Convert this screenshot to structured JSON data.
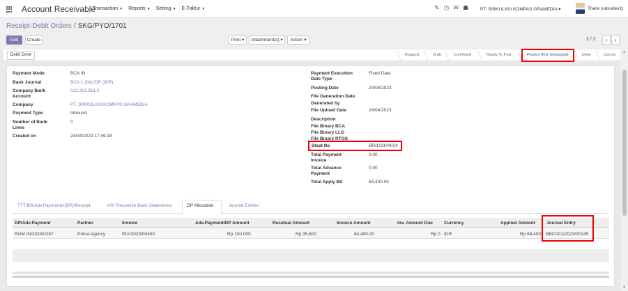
{
  "app": {
    "title": "Account Receivable"
  },
  "menu": {
    "items": [
      {
        "label": "Transaction"
      },
      {
        "label": "Reports"
      },
      {
        "label": "Setting"
      },
      {
        "label": "E-Faktur"
      }
    ]
  },
  "systray": {
    "company": "PT. SIRKULASI KOMPAS GRAMEDIA",
    "user": "There (odsodev2)",
    "icons": [
      "chat-icon",
      "clock-icon",
      "discuss-icon",
      "building-icon"
    ]
  },
  "breadcrumb": {
    "parent": "Receipt-Debit Orders",
    "separator": "/",
    "current": "SKG/PYO/1701"
  },
  "control": {
    "edit_label": "Edit",
    "create_label": "Create",
    "print_label": "Print",
    "attachments_label": "Attachment(s)",
    "action_label": "Action",
    "pager": "2 / 2"
  },
  "statusbar": {
    "button_label": "Debit Done",
    "stages": [
      {
        "label": "Request",
        "active": false
      },
      {
        "label": "Draft",
        "active": false
      },
      {
        "label": "Confirmed",
        "active": false
      },
      {
        "label": "Ready To Post",
        "active": false
      },
      {
        "label": "Posted (File Uploaded)",
        "active": true
      },
      {
        "label": "Done",
        "active": false
      },
      {
        "label": "Cancel",
        "active": false
      }
    ]
  },
  "form": {
    "left": [
      {
        "label": "Payment Mode",
        "value": "BCA IN"
      },
      {
        "label": "Bank Journal",
        "value": "BCA 1 (IN) IDR (IDR)"
      },
      {
        "label": "Company Bank Account",
        "value": "012.301.951.0"
      },
      {
        "label": "Company",
        "value": "PT. SIRKULASI KOMPAS GRAMEDIA"
      },
      {
        "label": "Payment Type",
        "value": "Inbound"
      },
      {
        "label": "Number of Bank Lines",
        "value": "0"
      },
      {
        "label": "Created on",
        "value": "24/04/2023 17:49:18"
      }
    ],
    "right": [
      {
        "label": "Payment Execution Date Type",
        "value": "Fixed Date"
      },
      {
        "label": "Posting Date",
        "value": "24/04/2023"
      },
      {
        "label": "File Generation Date",
        "value": ""
      },
      {
        "label": "Generated by",
        "value": ""
      },
      {
        "label": "File Upload Date",
        "value": "24/04/2023"
      },
      {
        "label": "Description",
        "value": ""
      },
      {
        "label": "File Binary BCA",
        "value": ""
      },
      {
        "label": "File Binary LLG",
        "value": ""
      },
      {
        "label": "File Binary RTGS",
        "value": ""
      },
      {
        "label": "Staat No",
        "value": "BR/1/23/04/24"
      },
      {
        "label": "Total Payment Invoice",
        "value": "0.00"
      },
      {
        "label": "Total Advance Payment",
        "value": "0.00"
      },
      {
        "label": "Total Apply BS",
        "value": "64,400.00"
      }
    ]
  },
  "tabs": [
    {
      "label": "TTT-BS/Adv.Payments/(DP)/Receipt",
      "active": false
    },
    {
      "label": "AR: Reconcile Bank Statements",
      "active": false
    },
    {
      "label": "DP Allocation",
      "active": true
    },
    {
      "label": "Journal Entries",
      "active": false
    }
  ],
  "table": {
    "columns": [
      "DP/Adv.Payment",
      "Partner",
      "Invoice",
      "Adv.Payment/DP Amount",
      "Residual Amount",
      "Invoice Amount",
      "Inv. Amount Due",
      "Currency",
      "Applied Amount",
      "Journal Entry"
    ],
    "rows": [
      [
        "RUM IN/2023/0287",
        "Prima Agency",
        "INV/2023/00450",
        "Rp 100,000",
        "Rp 35,600",
        "64,400.00",
        "Rp 0",
        "IDR",
        "Rp 64,400",
        "BBCA01/2023/00145"
      ]
    ]
  },
  "colors": {
    "accent": "#7c7bad",
    "highlight": "#e00000"
  }
}
